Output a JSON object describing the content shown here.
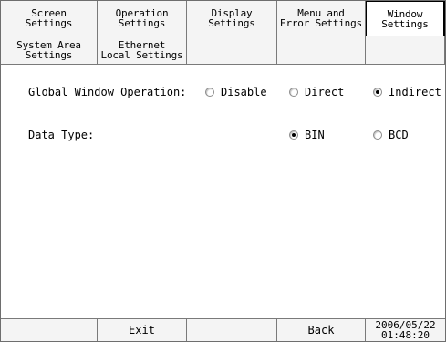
{
  "tabs_row1": [
    {
      "label": "Screen\nSettings"
    },
    {
      "label": "Operation\nSettings"
    },
    {
      "label": "Display\nSettings"
    },
    {
      "label": "Menu and\nError Settings"
    },
    {
      "label": "Window\nSettings",
      "active": true
    }
  ],
  "tabs_row2": [
    {
      "label": "System Area\nSettings"
    },
    {
      "label": "Ethernet\nLocal Settings"
    },
    {
      "label": ""
    },
    {
      "label": ""
    },
    {
      "label": ""
    }
  ],
  "global_window": {
    "label": "Global Window Operation:",
    "options": [
      "Disable",
      "Direct",
      "Indirect"
    ],
    "selected": "Indirect"
  },
  "data_type": {
    "label": "Data Type:",
    "options": [
      "BIN",
      "BCD"
    ],
    "selected": "BIN"
  },
  "bottom_bar": {
    "exit_label": "Exit",
    "back_label": "Back",
    "datetime": "2006/05/22\n01:48:20"
  },
  "colors": {
    "background": "#ffffff",
    "tab_background": "#f4f4f4",
    "border": "#7a7a7a"
  }
}
